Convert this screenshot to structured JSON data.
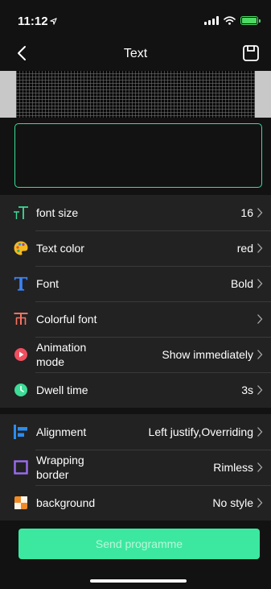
{
  "status_bar": {
    "time": "11:12"
  },
  "nav": {
    "title": "Text"
  },
  "input": {
    "value": "",
    "placeholder": ""
  },
  "settings": [
    {
      "key": "font-size",
      "label": "font size",
      "value": "16",
      "icon": "font-size-icon",
      "color": "#3ddc97"
    },
    {
      "key": "text-color",
      "label": "Text color",
      "value": "red",
      "icon": "palette-icon",
      "color": "#f5b921"
    },
    {
      "key": "font",
      "label": "Font",
      "value": "Bold",
      "icon": "font-icon",
      "color": "#3b82f6"
    },
    {
      "key": "colorful-font",
      "label": "Colorful font",
      "value": "",
      "icon": "colorful-font-icon",
      "color": "#f97362"
    },
    {
      "key": "animation-mode",
      "label": "Animation mode",
      "value": "Show immediately",
      "icon": "play-icon",
      "color": "#ef4f5f"
    },
    {
      "key": "dwell-time",
      "label": "Dwell time",
      "value": "3s",
      "icon": "clock-icon",
      "color": "#3ddc97"
    }
  ],
  "settings2": [
    {
      "key": "alignment",
      "label": "Alignment",
      "value": "Left justify,Overriding",
      "icon": "alignment-icon",
      "color": "#2b8cf0"
    },
    {
      "key": "wrapping-border",
      "label": "Wrapping border",
      "value": "Rimless",
      "icon": "border-icon",
      "color": "#9b6cf0"
    },
    {
      "key": "background",
      "label": "background",
      "value": "No style",
      "icon": "background-icon",
      "color": "#f08a24"
    }
  ],
  "send_button": {
    "label": "Send programme"
  }
}
